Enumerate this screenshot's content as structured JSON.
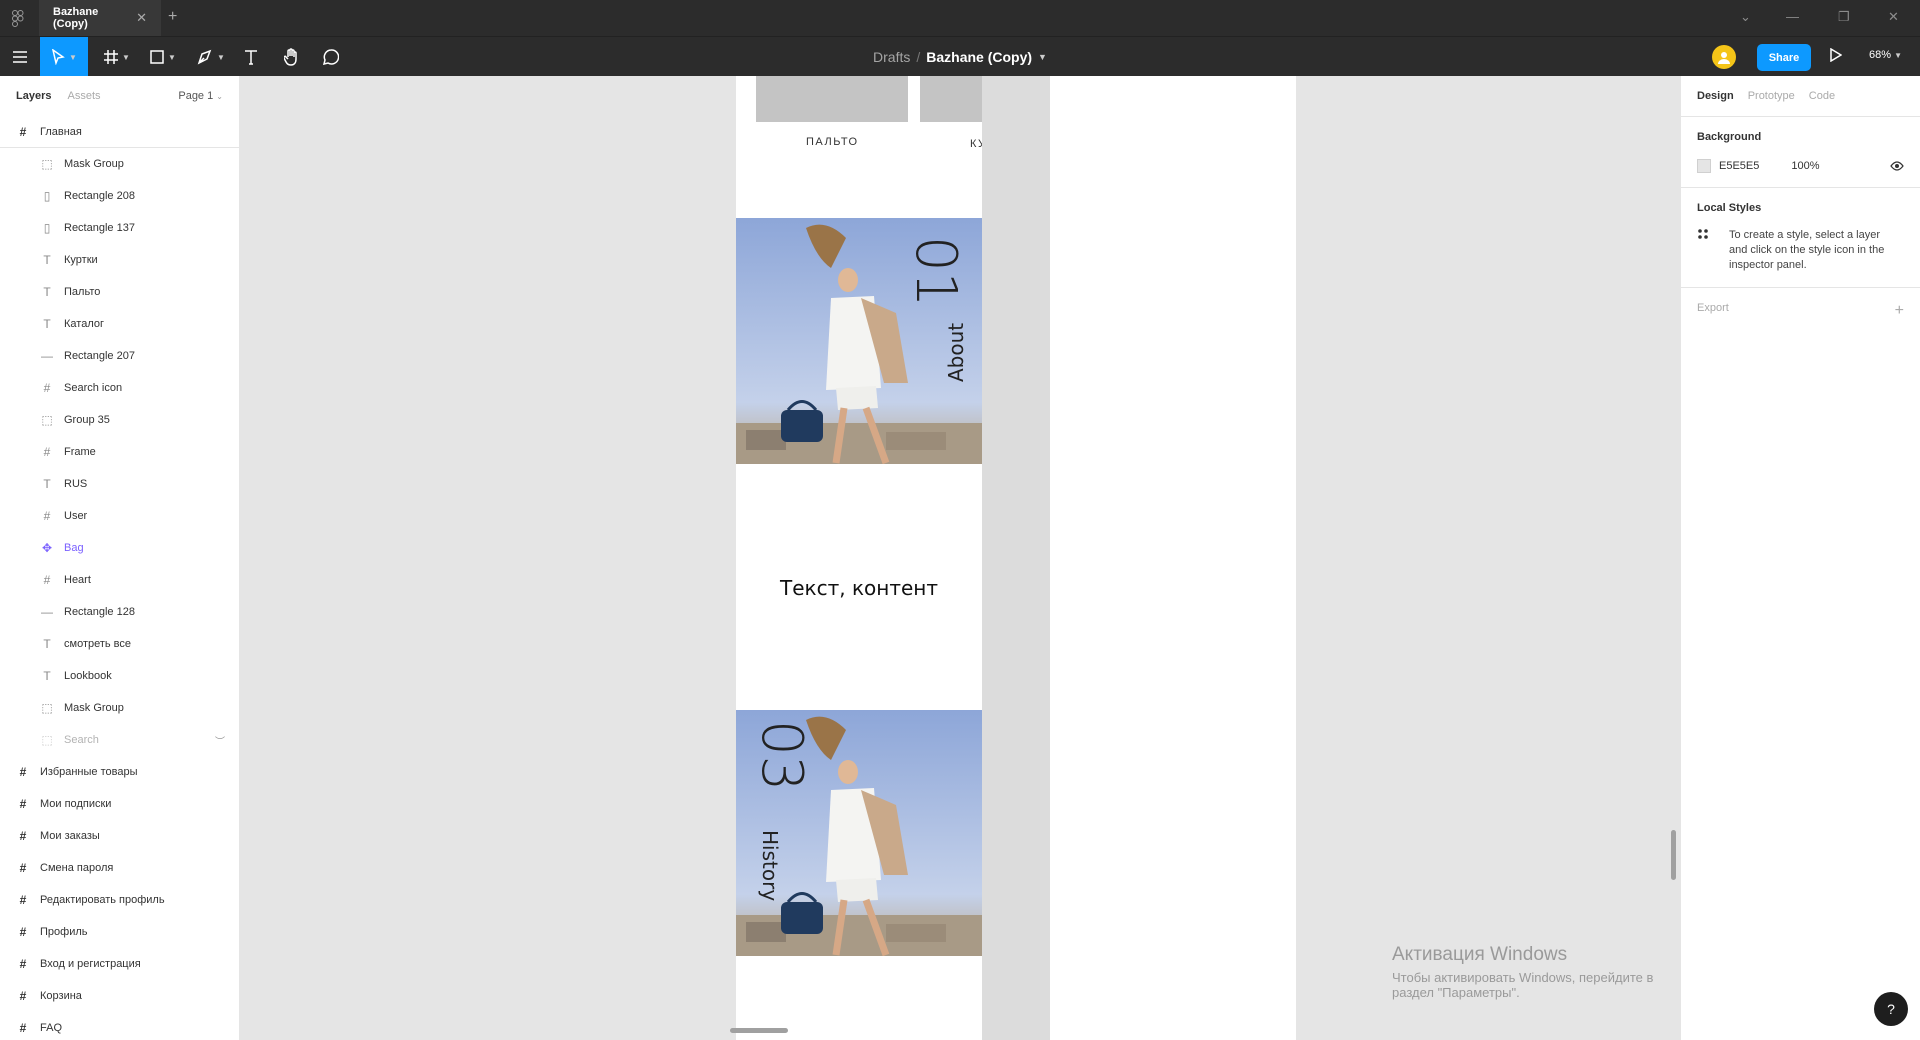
{
  "titlebar": {
    "tab_title": "Bazhane (Copy)",
    "tab_close": "✕",
    "new_tab": "+",
    "window_controls": [
      "⌄",
      "—",
      "❐",
      "✕"
    ]
  },
  "toolbar": {
    "breadcrumb_parent": "Drafts",
    "breadcrumb_sep": "/",
    "file_name": "Bazhane (Copy)",
    "share_label": "Share",
    "zoom_level": "68%",
    "accent_color": "#0d99ff"
  },
  "left_panel": {
    "tab_layers": "Layers",
    "tab_assets": "Assets",
    "page_selector": "Page 1",
    "frame_main": "Главная",
    "children": [
      {
        "label": "Mask Group",
        "icon": "mask-group-icon",
        "glyph": "⬚"
      },
      {
        "label": "Rectangle 208",
        "icon": "rectangle-icon",
        "glyph": "▯"
      },
      {
        "label": "Rectangle 137",
        "icon": "rectangle-icon",
        "glyph": "▯"
      },
      {
        "label": "Куртки",
        "icon": "text-icon",
        "glyph": "T"
      },
      {
        "label": "Пальто",
        "icon": "text-icon",
        "glyph": "T"
      },
      {
        "label": "Каталог",
        "icon": "text-icon",
        "glyph": "T"
      },
      {
        "label": "Rectangle 207",
        "icon": "line-icon",
        "glyph": "—"
      },
      {
        "label": "Search icon",
        "icon": "frame-icon",
        "glyph": "#"
      },
      {
        "label": "Group 35",
        "icon": "group-icon",
        "glyph": "⬚"
      },
      {
        "label": "Frame",
        "icon": "frame-icon",
        "glyph": "#"
      },
      {
        "label": "RUS",
        "icon": "text-icon",
        "glyph": "T"
      },
      {
        "label": "User",
        "icon": "frame-icon",
        "glyph": "#"
      },
      {
        "label": "Bag",
        "icon": "component-icon",
        "glyph": "✥"
      },
      {
        "label": "Heart",
        "icon": "frame-icon",
        "glyph": "#"
      },
      {
        "label": "Rectangle 128",
        "icon": "line-icon",
        "glyph": "—"
      },
      {
        "label": "смотреть все",
        "icon": "text-icon",
        "glyph": "T"
      },
      {
        "label": "Lookbook",
        "icon": "text-icon",
        "glyph": "T"
      },
      {
        "label": "Mask Group",
        "icon": "mask-group-icon",
        "glyph": "⬚"
      }
    ],
    "hidden_layer": "Search",
    "top_frames": [
      "Избранные товары",
      "Мои подписки",
      "Мои заказы",
      "Смена пароля",
      "Редактировать профиль",
      "Профиль",
      "Вход и регистрация",
      "Корзина",
      "FAQ"
    ]
  },
  "canvas": {
    "category_1": "ПАЛЬТО",
    "category_2": "КУ",
    "about_number": "01",
    "about_label": "About",
    "content_text": "Текст, контент",
    "history_number": "03",
    "history_label": "History",
    "windows_activation_title": "Активация Windows",
    "windows_activation_sub": "Чтобы активировать Windows, перейдите в раздел \"Параметры\"."
  },
  "right_panel": {
    "tab_design": "Design",
    "tab_prototype": "Prototype",
    "tab_code": "Code",
    "background_title": "Background",
    "bg_hex": "E5E5E5",
    "bg_opacity": "100%",
    "bg_color": "#e5e5e5",
    "local_styles_title": "Local Styles",
    "local_styles_hint": "To create a style, select a layer and click on the style icon in the inspector panel.",
    "export_title": "Export",
    "export_add": "+"
  },
  "help_label": "?"
}
